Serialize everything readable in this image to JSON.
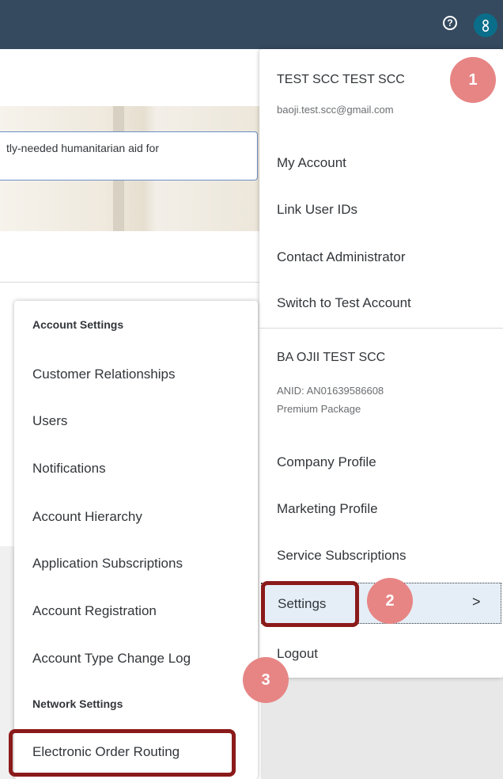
{
  "topbar": {
    "help_icon": "question-circle-icon",
    "help_glyph": "?",
    "avatar_icon": "user-icon",
    "bg_color": "#354a5f",
    "avatar_color": "#0a6e8a"
  },
  "banner": {
    "text": "tly-needed humanitarian aid for"
  },
  "profile_menu": {
    "user_name": "TEST SCC TEST SCC",
    "user_email": "baoji.test.scc@gmail.com",
    "items_top": [
      "My Account",
      "Link User IDs",
      "Contact Administrator",
      "Switch to Test Account"
    ],
    "company_name": "BA OJII TEST SCC",
    "anid": "ANID: AN01639586608",
    "package": "Premium Package",
    "items_company": [
      "Company Profile",
      "Marketing Profile",
      "Service Subscriptions"
    ],
    "settings_label": "Settings",
    "settings_chevron": ">",
    "logout_label": "Logout"
  },
  "settings_menu": {
    "account_header": "Account Settings",
    "account_items": [
      "Customer Relationships",
      "Users",
      "Notifications",
      "Account Hierarchy",
      "Application Subscriptions",
      "Account Registration",
      "Account Type Change Log"
    ],
    "network_header": "Network Settings",
    "network_items": [
      "Electronic Order Routing"
    ]
  },
  "annotations": {
    "step1": "1",
    "step2": "2",
    "step3": "3",
    "highlight_color": "#8b1a1a",
    "badge_color": "#e78585"
  }
}
